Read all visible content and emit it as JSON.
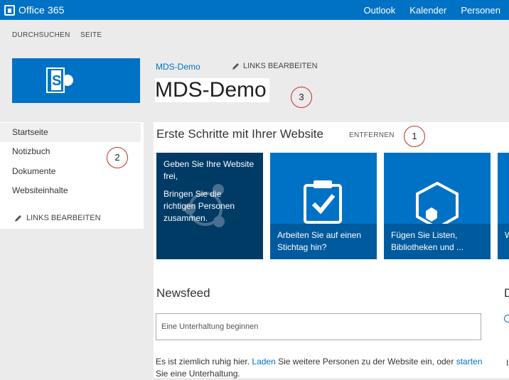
{
  "suite_bar": {
    "brand": "Office 365",
    "nav": [
      "Outlook",
      "Kalender",
      "Personen"
    ]
  },
  "ribbon": {
    "browse": "DURCHSUCHEN",
    "page": "SEITE"
  },
  "header": {
    "breadcrumb": "MDS-Demo",
    "edit_links": "LINKS BEARBEITEN",
    "site_title": "MDS-Demo"
  },
  "left_nav": {
    "items": [
      "Startseite",
      "Notizbuch",
      "Dokumente",
      "Websiteinhalte"
    ],
    "selected": "Startseite",
    "edit_links": "LINKS BEARBEITEN"
  },
  "getting_started": {
    "title": "Erste Schritte mit Ihrer Website",
    "remove": "ENTFERNEN",
    "tiles": [
      {
        "lines": [
          "Geben Sie Ihre Website frei,",
          "Bringen Sie die richtigen Personen zusammen."
        ],
        "icon": "share-network-icon"
      },
      {
        "caption": "Arbeiten Sie auf einen Stichtag hin?",
        "icon": "clipboard-check-icon"
      },
      {
        "caption": "Fügen Sie Listen, Bibliotheken und ...",
        "icon": "hexagon-icon"
      },
      {
        "caption": "W"
      }
    ]
  },
  "newsfeed": {
    "title": "Newsfeed",
    "placeholder": "Eine Unterhaltung beginnen",
    "text_a": "Es ist ziemlich ruhig hier. ",
    "link_invite": "Laden",
    "text_b": " Sie weitere Personen zu der Website ein, oder ",
    "link_start": "starten",
    "text_c": " Sie eine Unterhaltung."
  },
  "right_cut": {
    "heading": "D",
    "line": "I"
  },
  "annotations": [
    "1",
    "2",
    "3"
  ],
  "colors": {
    "suite_bar": "#0072c6",
    "tile_dark": "#003b66",
    "tile_blue": "#0072c6",
    "badge_ring": "#c0302a"
  }
}
